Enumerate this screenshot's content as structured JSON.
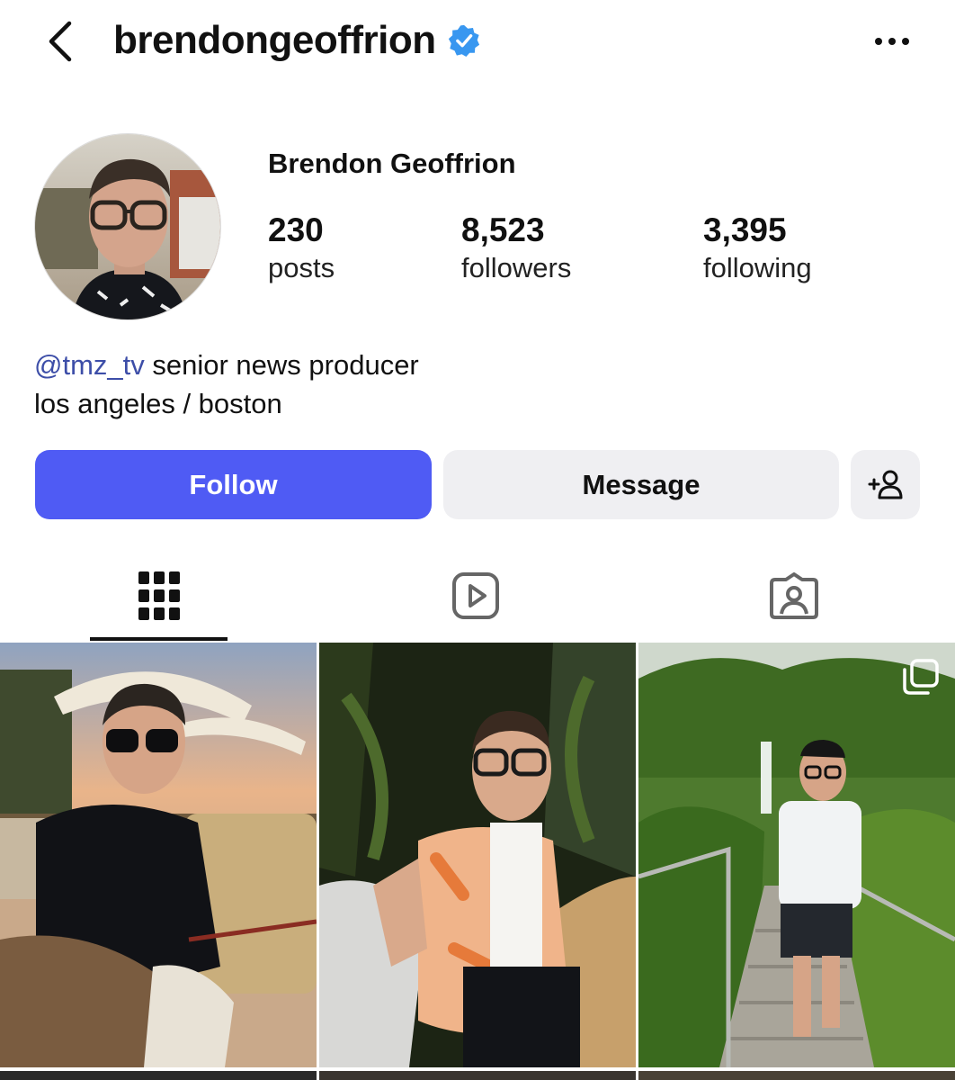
{
  "header": {
    "username": "brendongeoffrion",
    "back_icon": "chevron-left-icon",
    "verified_icon": "verified-badge-icon",
    "more_icon": "more-horizontal-icon"
  },
  "profile": {
    "display_name": "Brendon Geoffrion",
    "stats": {
      "posts": {
        "value": "230",
        "label": "posts"
      },
      "followers": {
        "value": "8,523",
        "label": "followers"
      },
      "following": {
        "value": "3,395",
        "label": "following"
      }
    },
    "bio": {
      "mention": "@tmz_tv",
      "line1_rest": " senior news producer",
      "line2": "los angeles / boston"
    }
  },
  "actions": {
    "follow_label": "Follow",
    "message_label": "Message",
    "add_user_icon": "add-person-icon"
  },
  "tabs": [
    {
      "name": "grid",
      "icon": "grid-icon",
      "selected": true
    },
    {
      "name": "reels",
      "icon": "reels-icon",
      "selected": false
    },
    {
      "name": "tagged",
      "icon": "tagged-icon",
      "selected": false
    }
  ],
  "colors": {
    "follow_button": "#4f5bf4",
    "mention": "#3d4ea8",
    "verified": "#3897f0"
  }
}
